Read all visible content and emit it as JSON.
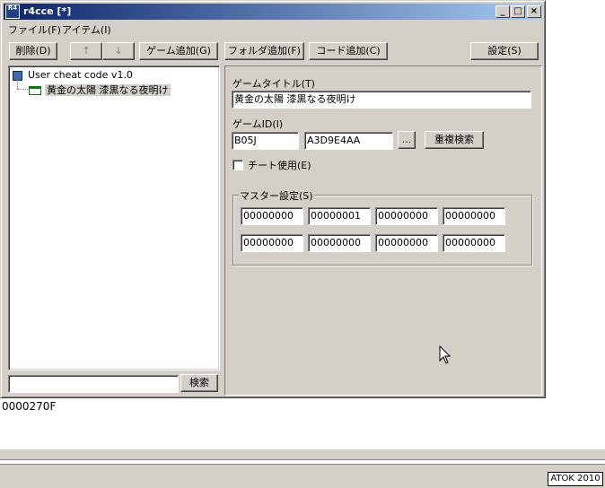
{
  "window": {
    "icon_label": "R4",
    "title": "r4cce [*]",
    "minimize_glyph": "_",
    "maximize_glyph": "□",
    "close_glyph": "×"
  },
  "menubar": {
    "file": "ファイル(F)",
    "item": "アイテム(I)"
  },
  "toolbar": {
    "delete": "削除(D)",
    "up": "↑",
    "down": "↓",
    "add_game": "ゲーム追加(G)",
    "add_folder": "フォルダ追加(F)",
    "add_code": "コード追加(C)",
    "settings": "設定(S)"
  },
  "tree": {
    "root": "User cheat code v1.0",
    "child": "黄金の太陽 漆黒なる夜明け"
  },
  "search": {
    "value": "",
    "button": "検索"
  },
  "details": {
    "game_title_label": "ゲームタイトル(T)",
    "game_title_value": "黄金の太陽 漆黒なる夜明け",
    "game_id_label": "ゲームID(I)",
    "game_id_value": "B05J",
    "crc_value": "A3D9E4AA",
    "browse_button": "...",
    "dup_search_button": "重複検索",
    "use_cheat_label": "チート使用(E)",
    "use_cheat_checked": false,
    "master_label": "マスター設定(S)",
    "master_row1": [
      "00000000",
      "00000001",
      "00000000",
      "00000000"
    ],
    "master_row2": [
      "00000000",
      "00000000",
      "00000000",
      "00000000"
    ]
  },
  "below_window_text": "0000270F",
  "ime": {
    "label": "ATOK 2010"
  }
}
